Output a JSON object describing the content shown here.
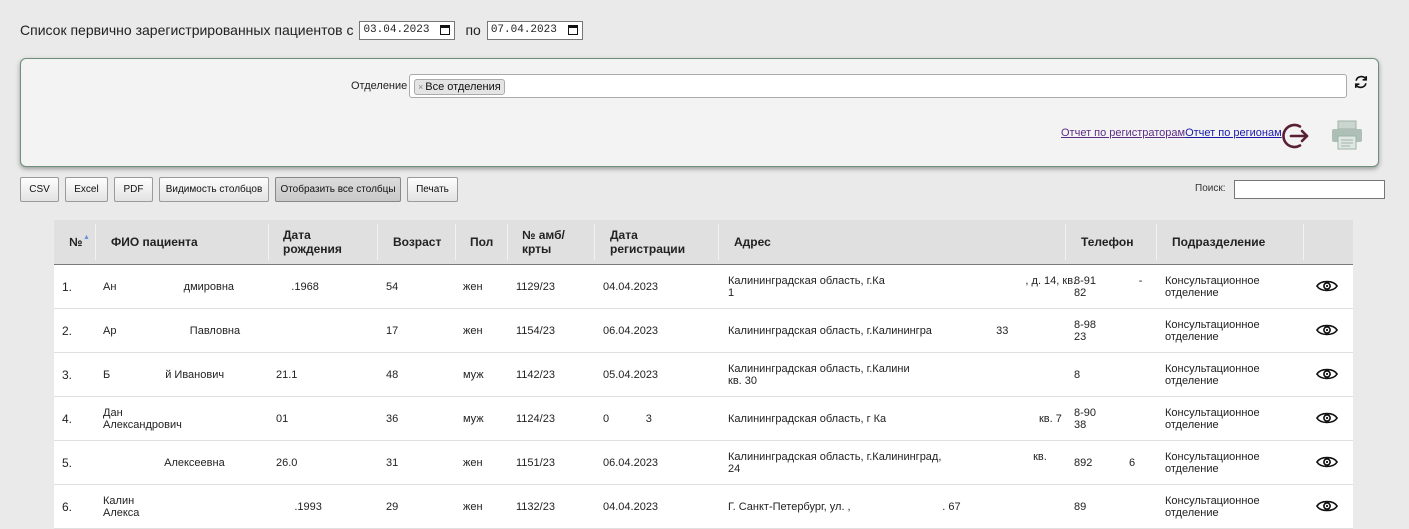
{
  "header": {
    "prefix": "Список первично зарегистрированных пациентов с",
    "date_from": "03.04.2023",
    "separator": "по",
    "date_to": "07.04.2023"
  },
  "filter": {
    "department_label": "Отделение",
    "department_chip": "Все отделения",
    "chip_remove": "×",
    "refresh_icon": "refresh-icon",
    "logout_icon": "logout-icon",
    "print_icon": "printer-icon"
  },
  "links": {
    "by_registrars": "Отчет по регистраторам",
    "by_regions": "Отчет по регионам"
  },
  "toolbar": {
    "csv": "CSV",
    "excel": "Excel",
    "pdf": "PDF",
    "visibility": "Видимость столбцов",
    "show_all": "Отобразить все столбцы",
    "print": "Печать",
    "search_label": "Поиск:"
  },
  "table": {
    "headers": {
      "num": "№",
      "fio": "ФИО пациента",
      "dob": "Дата\nрождения",
      "age": "Возраст",
      "sex": "Пол",
      "card": "№ амб/\nкрты",
      "reg": "Дата\nрегистрации",
      "addr": "Адрес",
      "phone": "Телефон",
      "dept": "Подразделение"
    },
    "rows": [
      {
        "num": "1.",
        "fio": "Ан                      дмировна",
        "dob": "     .1968",
        "age": "54",
        "sex": "жен",
        "card": "1129/23",
        "reg": "04.04.2023",
        "addr": "Калининградская область, г.Ка                                              , д. 14, кв.\n1",
        "phone": "8-91              -\n82",
        "dept": "Консультационное\nотделение"
      },
      {
        "num": "2.",
        "fio": "Ар                        Павловна",
        "dob": "",
        "age": "17",
        "sex": "жен",
        "card": "1154/23",
        "reg": "06.04.2023",
        "addr": "Калининградская область, г.Калинингра                     33",
        "phone": "8-98\n23",
        "dept": "Консультационное\nотделение"
      },
      {
        "num": "3.",
        "fio": "Б                  й Иванович",
        "dob": "21.1",
        "age": "48",
        "sex": "муж",
        "card": "1142/23",
        "reg": "05.04.2023",
        "addr": "Калининградская область, г.Калини\nкв. 30",
        "phone": "8",
        "dept": "Консультационное\nотделение"
      },
      {
        "num": "4.",
        "fio": "Дан\nАлександрович",
        "dob": "01",
        "age": "36",
        "sex": "муж",
        "card": "1124/23",
        "reg": "0            3",
        "addr": "Калининградская область, г Ка                                                  кв. 7",
        "phone": "8-90\n38",
        "dept": "Консультационное\nотделение"
      },
      {
        "num": "5.",
        "fio": "                    Алексеевна",
        "dob": "26.0",
        "age": "31",
        "sex": "жен",
        "card": "1151/23",
        "reg": "06.04.2023",
        "addr": "Калининградская область, г.Калининград,                              кв.\n24",
        "phone": "892            6",
        "dept": "Консультационное\nотделение"
      },
      {
        "num": "6.",
        "fio": "Калин\nАлекса",
        "dob": "      .1993",
        "age": "29",
        "sex": "жен",
        "card": "1132/23",
        "reg": "04.04.2023",
        "addr": "Г. Санкт-Петербург, ул. ,                              . 67",
        "phone": "89",
        "dept": "Консультационное\nотделение"
      }
    ],
    "row_action_icon": "eye-icon"
  }
}
